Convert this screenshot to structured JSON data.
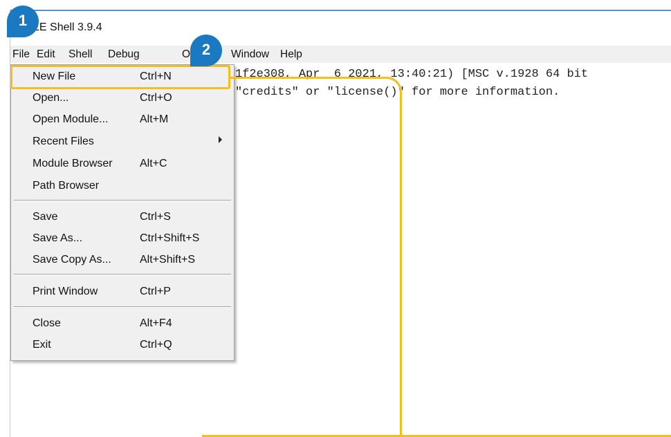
{
  "window": {
    "title": "IDLE Shell 3.9.4"
  },
  "menubar": [
    "File",
    "Edit",
    "Shell",
    "Debug",
    "Options",
    "Window",
    "Help"
  ],
  "shell_lines": [
    "1f2e308, Apr  6 2021, 13:40:21) [MSC v.1928 64 bit",
    "\"credits\" or \"license()\" for more information."
  ],
  "file_menu": {
    "items": [
      {
        "label": "New File",
        "shortcut": "Ctrl+N"
      },
      {
        "label": "Open...",
        "shortcut": "Ctrl+O"
      },
      {
        "label": "Open Module...",
        "shortcut": "Alt+M"
      },
      {
        "label": "Recent Files",
        "shortcut": ""
      },
      {
        "label": "Module Browser",
        "shortcut": "Alt+C"
      },
      {
        "label": "Path Browser",
        "shortcut": ""
      },
      {
        "label": "Save",
        "shortcut": "Ctrl+S"
      },
      {
        "label": "Save As...",
        "shortcut": "Ctrl+Shift+S"
      },
      {
        "label": "Save Copy As...",
        "shortcut": "Alt+Shift+S"
      },
      {
        "label": "Print Window",
        "shortcut": "Ctrl+P"
      },
      {
        "label": "Close",
        "shortcut": "Alt+F4"
      },
      {
        "label": "Exit",
        "shortcut": "Ctrl+Q"
      }
    ]
  },
  "annotations": {
    "step1": "1",
    "step2": "2",
    "highlight_color": "#f5be1d",
    "badge_color": "#1a79c0"
  }
}
